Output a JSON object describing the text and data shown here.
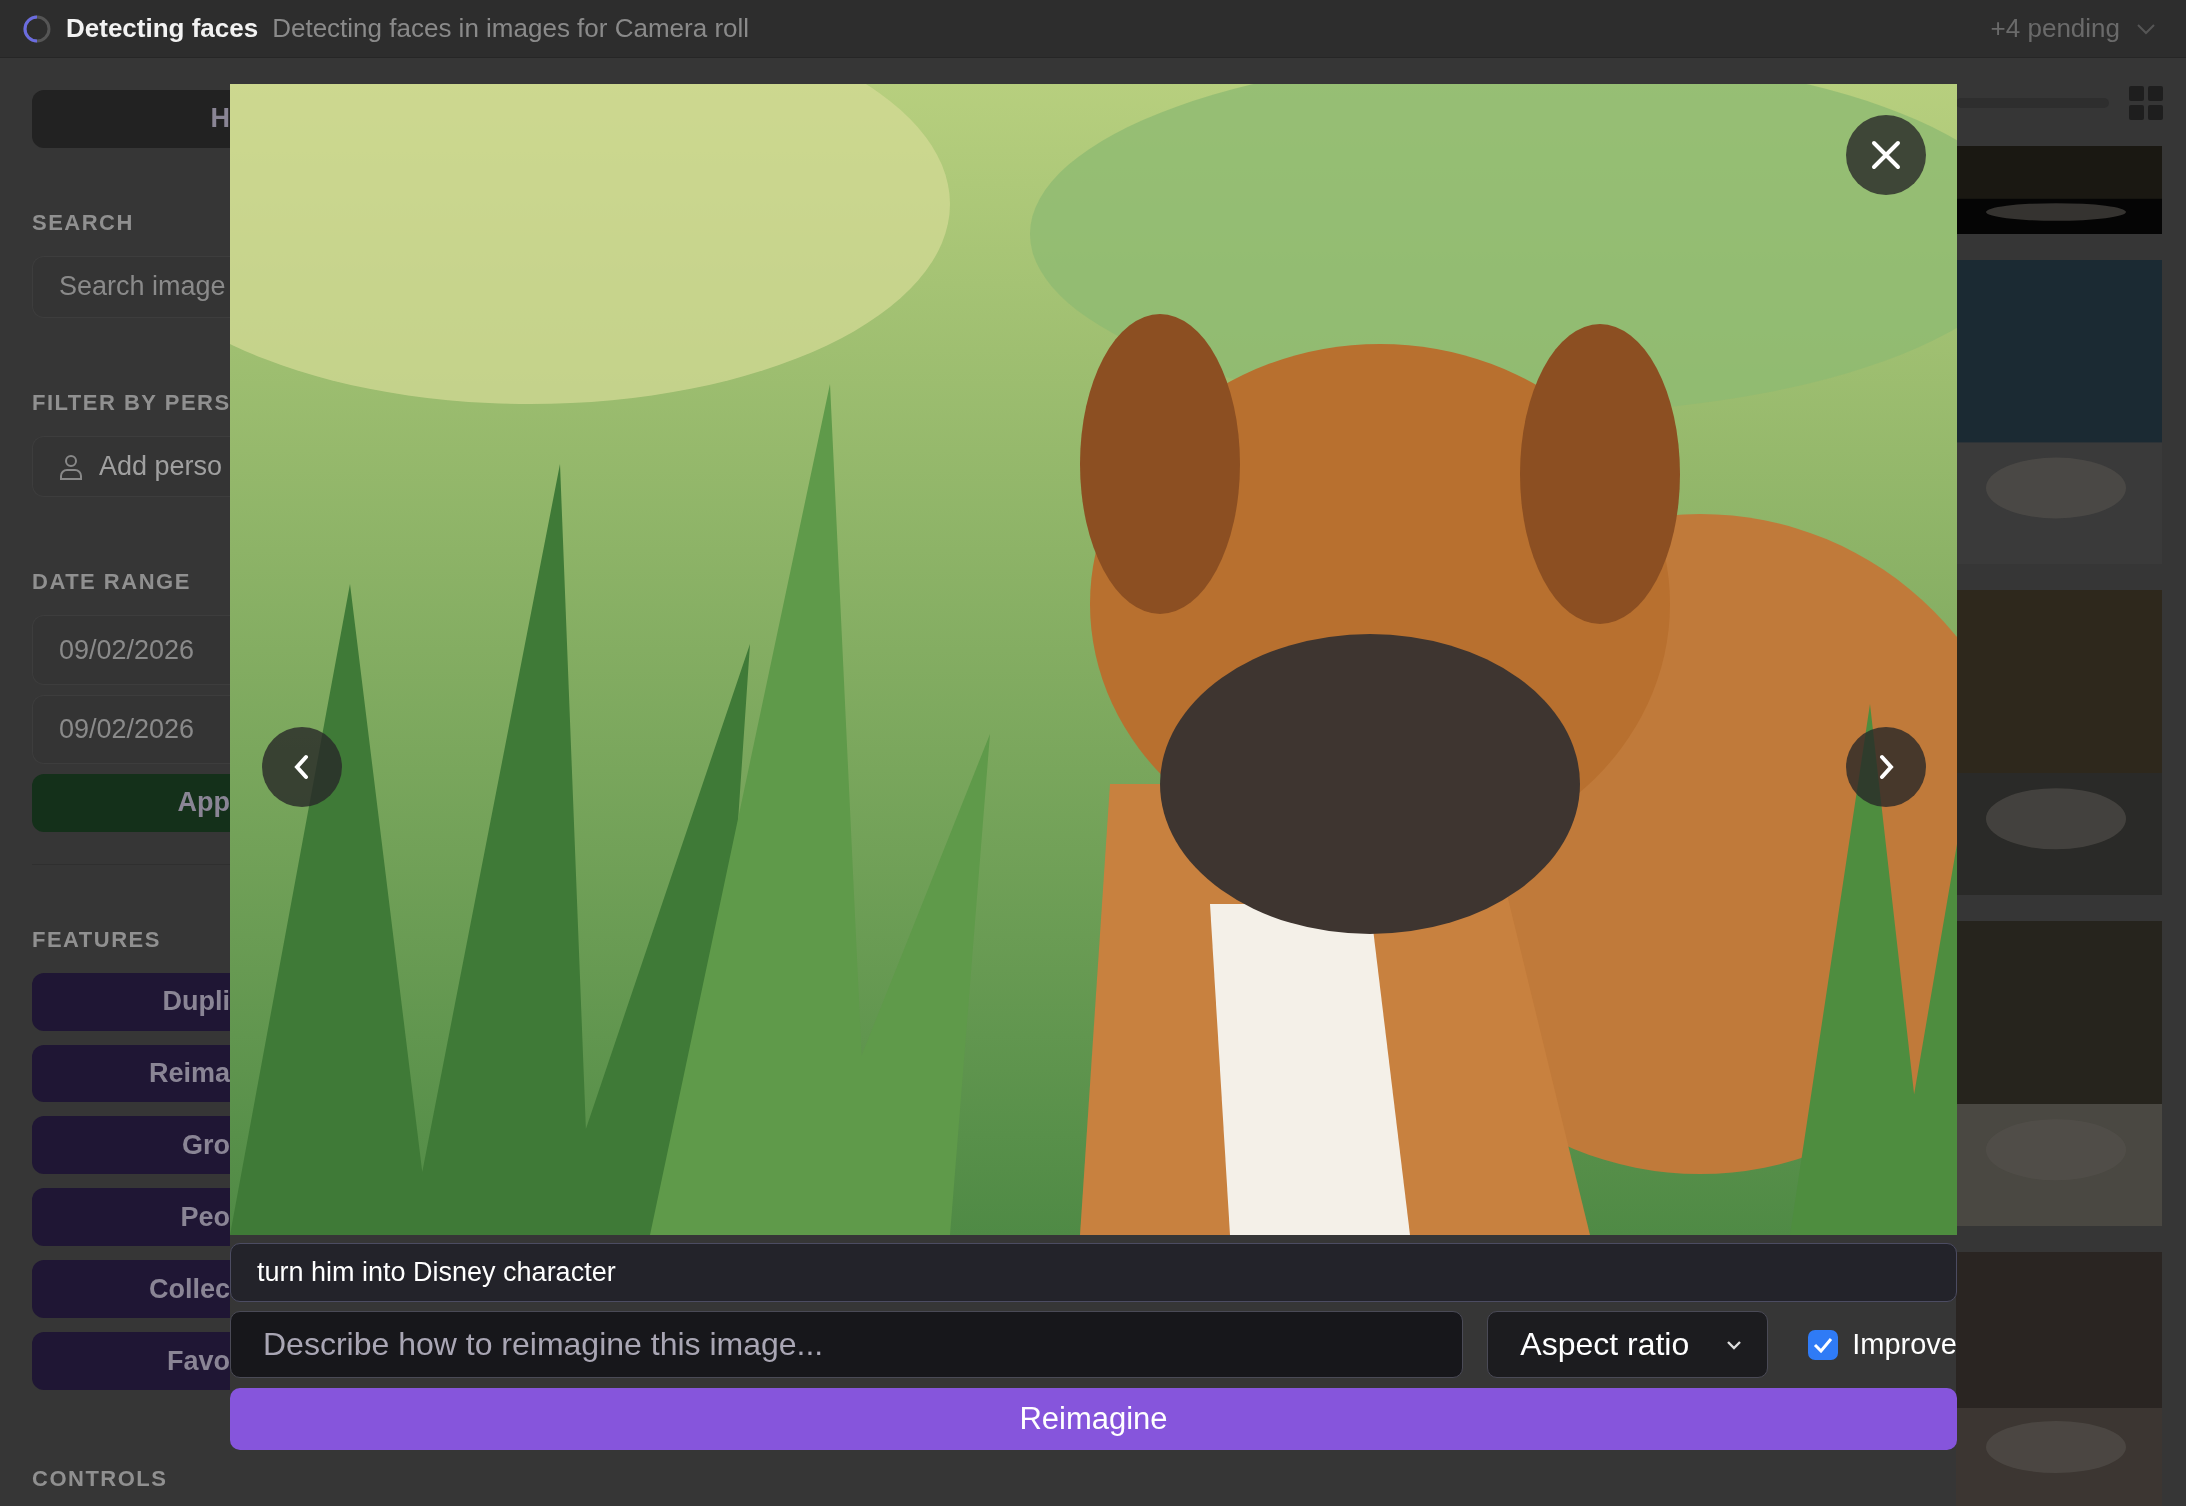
{
  "top_bar": {
    "title": "Detecting faces",
    "subtitle": "Detecting faces in images for Camera roll",
    "pending": "+4 pending"
  },
  "sidebar": [
    {
      "kind": "button",
      "label": "H",
      "color": "#222222"
    },
    {
      "kind": "heading",
      "label": "SEARCH"
    },
    {
      "kind": "field",
      "placeholder": "Search image"
    },
    {
      "kind": "heading",
      "label": "FILTER BY PERS"
    },
    {
      "kind": "person",
      "label": "Add perso"
    },
    {
      "kind": "heading",
      "label": "DATE RANGE"
    },
    {
      "kind": "date",
      "value": "09/02/2026"
    },
    {
      "kind": "date",
      "value": "09/02/2026"
    },
    {
      "kind": "button",
      "label": "App",
      "color": "#14301a"
    },
    {
      "kind": "divider"
    },
    {
      "kind": "heading",
      "label": "FEATURES"
    },
    {
      "kind": "button",
      "label": "Dupli",
      "color": "#1f1634"
    },
    {
      "kind": "button",
      "label": "Reima",
      "color": "#1f1634"
    },
    {
      "kind": "button",
      "label": "Gro",
      "color": "#1f1634"
    },
    {
      "kind": "button",
      "label": "Peo",
      "color": "#1f1634"
    },
    {
      "kind": "button",
      "label": "Collec",
      "color": "#1f1634"
    },
    {
      "kind": "button",
      "label": "Favo",
      "color": "#1f1634"
    },
    {
      "kind": "heading",
      "label": "CONTROLS"
    }
  ],
  "viewer": {
    "prompt_text": "turn him into Disney character",
    "input": {
      "placeholder": "Describe how to reimagine this image..."
    },
    "aspect_select": "Aspect ratio",
    "improve": {
      "label": "Improve",
      "checked": true
    },
    "submit": "Reimagine"
  }
}
